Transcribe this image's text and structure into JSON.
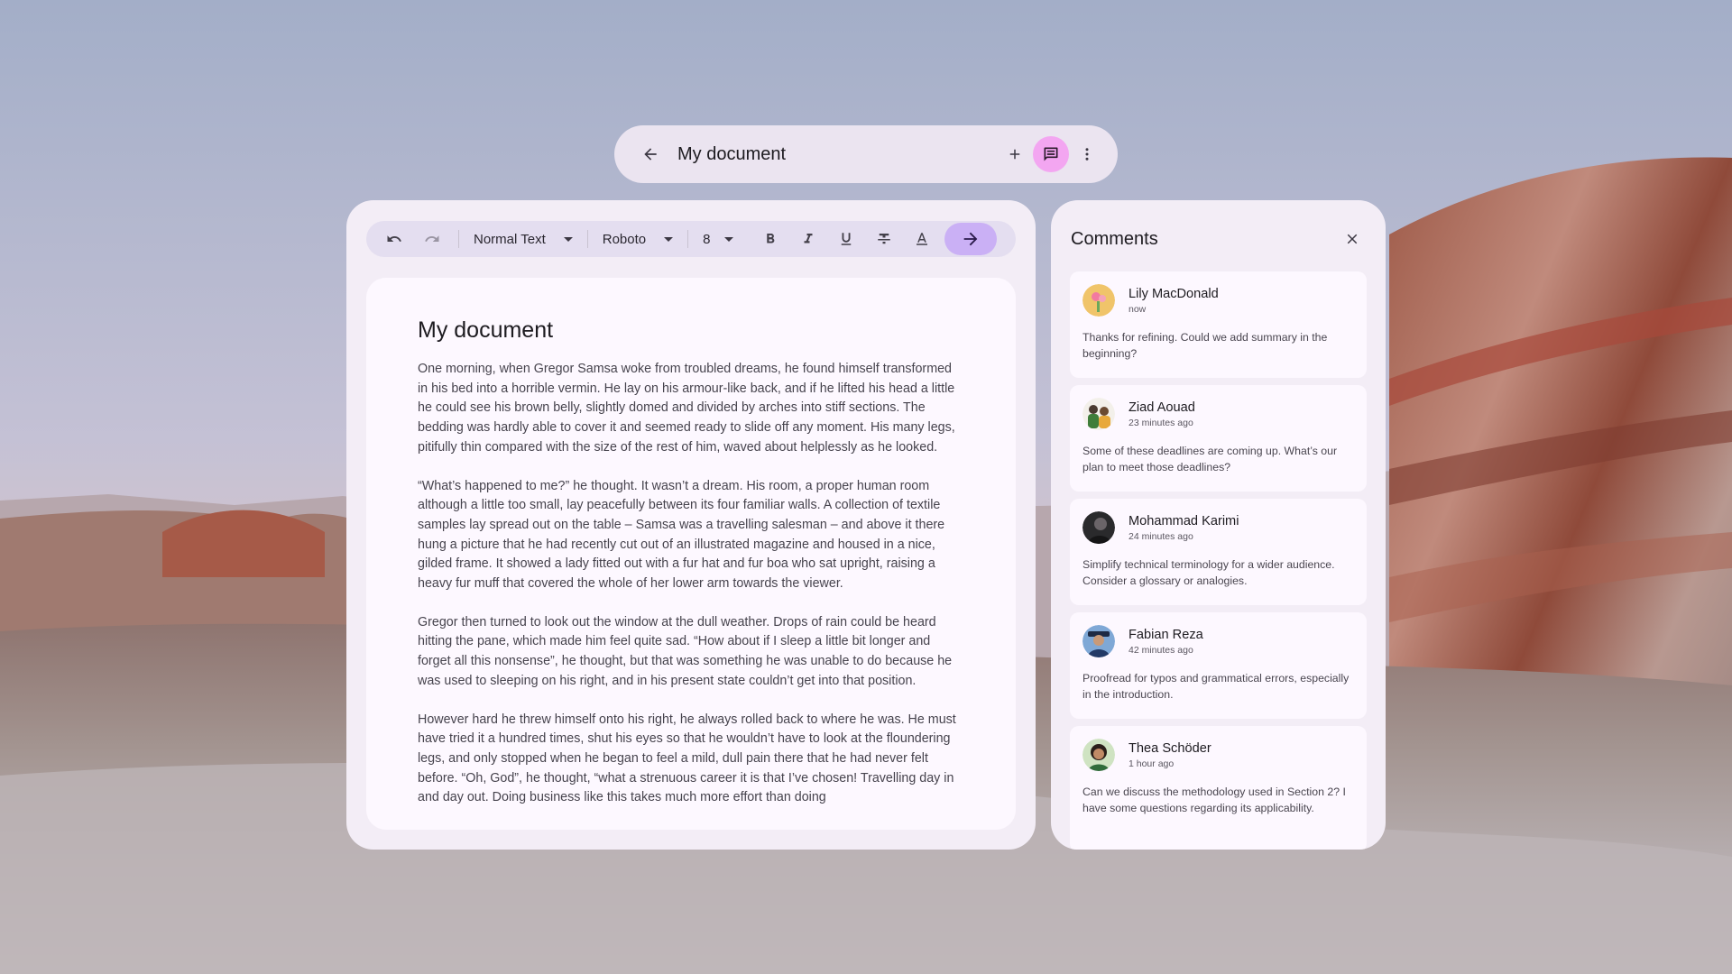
{
  "appbar": {
    "title": "My document",
    "back_icon": "arrow-back-icon",
    "add_icon": "plus-icon",
    "comment_icon": "comment-icon",
    "more_icon": "more-vert-icon",
    "accent": "#f3a6f1"
  },
  "toolbar": {
    "text_style": "Normal Text",
    "font": "Roboto",
    "font_size": "8",
    "send_accent": "#cab0f5"
  },
  "document": {
    "title": "My document",
    "paragraphs": [
      "One morning, when Gregor Samsa woke from troubled dreams, he found himself transformed in his bed into a horrible vermin. He lay on his armour-like back, and if he lifted his head a little he could see his brown belly, slightly domed and divided by arches into stiff sections. The bedding was hardly able to cover it and seemed ready to slide off any moment. His many legs, pitifully thin compared with the size of the rest of him, waved about helplessly as he looked.",
      "“What’s happened to me?” he thought. It wasn’t a dream. His room, a proper human room although a little too small, lay peacefully between its four familiar walls. A collection of textile samples lay spread out on the table – Samsa was a travelling salesman – and above it there hung a picture that he had recently cut out of an illustrated magazine and housed in a nice, gilded frame. It showed a lady fitted out with a fur hat and fur boa who sat upright, raising a heavy fur muff that covered the whole of her lower arm towards the viewer.",
      "Gregor then turned to look out the window at the dull weather. Drops of rain could be heard hitting the pane, which made him feel quite sad. “How about if I sleep a little bit longer and forget all this nonsense”, he thought, but that was something he was unable to do because he was used to sleeping on his right, and in his present state couldn’t get into that position.",
      "However hard he threw himself onto his right, he always rolled back to where he was. He must have tried it a hundred times, shut his eyes so that he wouldn’t have to look at the floundering legs, and only stopped when he began to feel a mild, dull pain there that he had never felt before. “Oh, God”, he thought, “what a strenuous career it is that I’ve chosen! Travelling day in and day out. Doing business like this takes much more effort than doing"
    ]
  },
  "comments": {
    "title": "Comments",
    "items": [
      {
        "name": "Lily MacDonald",
        "time": "now",
        "text": "Thanks for refining. Could we add summary in the beginning?"
      },
      {
        "name": "Ziad Aouad",
        "time": "23 minutes ago",
        "text": "Some of these deadlines are coming up. What’s our plan to meet those deadlines?"
      },
      {
        "name": "Mohammad Karimi",
        "time": "24 minutes ago",
        "text": "Simplify technical terminology for a wider audience. Consider a glossary or analogies."
      },
      {
        "name": "Fabian Reza",
        "time": "42 minutes ago",
        "text": "Proofread for typos and grammatical errors, especially in the introduction."
      },
      {
        "name": "Thea Schöder",
        "time": "1 hour ago",
        "text": "Can we discuss the methodology used in Section 2? I have some questions regarding its applicability."
      }
    ]
  }
}
